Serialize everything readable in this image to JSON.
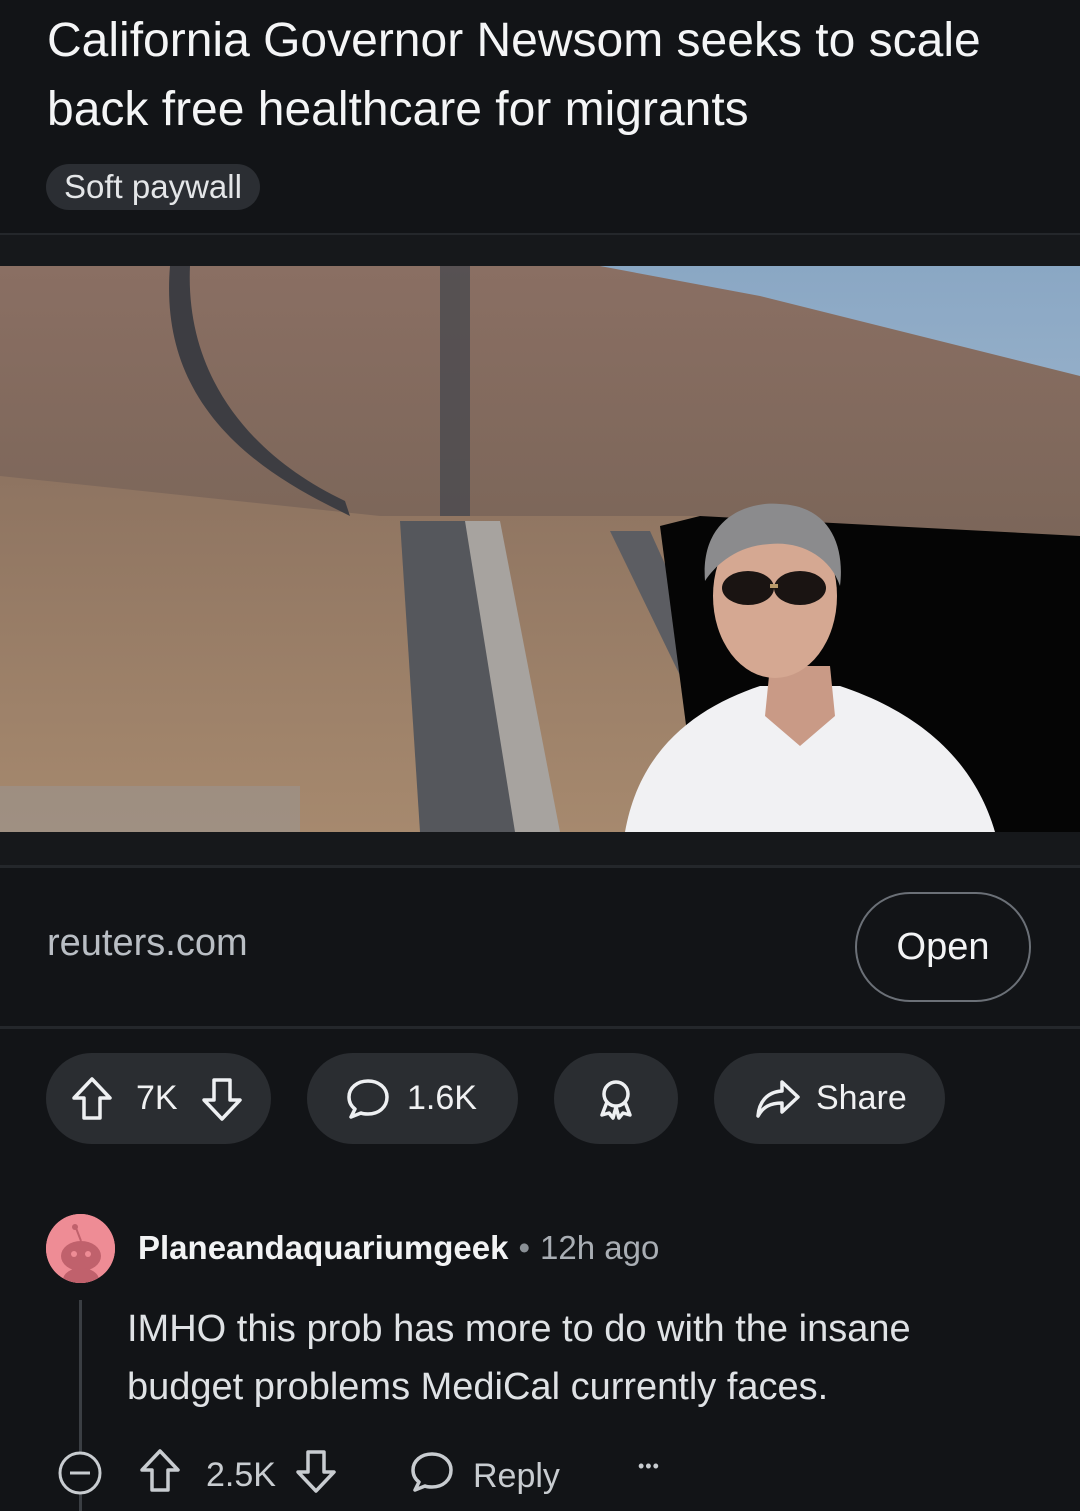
{
  "post": {
    "title": "California Governor Newsom seeks to scale back free healthcare for migrants",
    "flair": "Soft paywall"
  },
  "link": {
    "domain": "reuters.com",
    "open_label": "Open"
  },
  "actions": {
    "upvotes": "7K",
    "comments": "1.6K",
    "share_label": "Share"
  },
  "comment": {
    "username": "Planeandaquariumgeek",
    "separator": "•",
    "time": "12h ago",
    "body": "IMHO this prob has more to do with the insane budget problems MediCal currently faces.",
    "score": "2.5K",
    "reply_label": "Reply",
    "more_label": "•••"
  },
  "icons": {
    "upvote": "arrow-up-outline-icon",
    "downvote": "arrow-down-outline-icon",
    "comments": "speech-bubble-icon",
    "award": "award-icon",
    "share": "share-arrow-icon",
    "collapse": "minus-circle-icon",
    "more": "ellipsis-icon"
  },
  "colors": {
    "background": "#121417",
    "pill": "#2a2d31",
    "avatar": "#ee8c95"
  }
}
